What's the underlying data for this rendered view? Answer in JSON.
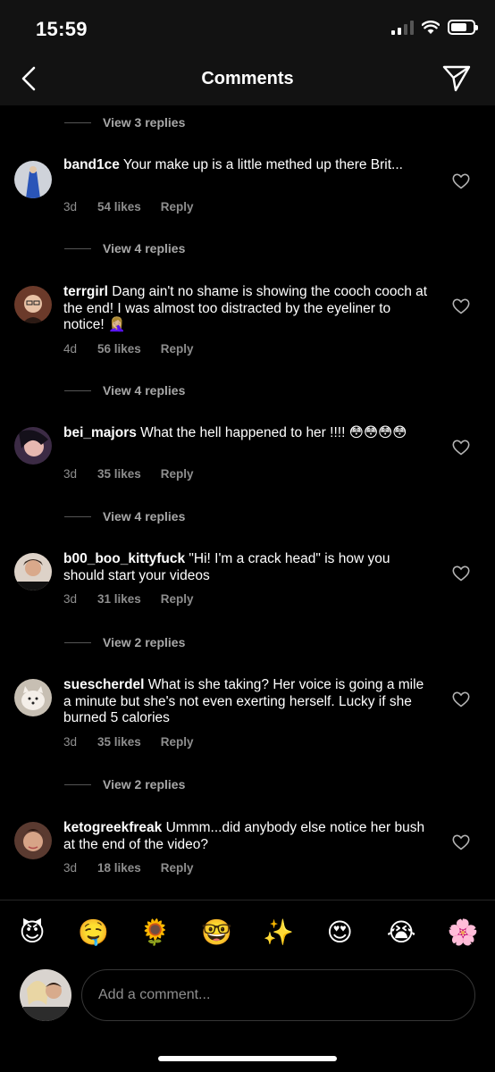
{
  "status": {
    "time": "15:59"
  },
  "header": {
    "title": "Comments"
  },
  "comments": [
    {
      "view_replies": "View 3 replies"
    },
    {
      "username": "band1ce",
      "text": " Your make up is a little methed up there Brit...",
      "time": "3d",
      "likes": "54 likes",
      "reply": "Reply",
      "view_replies": "View 4 replies"
    },
    {
      "username": "terrgirl",
      "text": " Dang ain't no shame is showing the cooch cooch at the end! I was almost too distracted by the eyeliner to notice! 🤦🏼‍♀️",
      "time": "4d",
      "likes": "56 likes",
      "reply": "Reply",
      "view_replies": "View 4 replies"
    },
    {
      "username": "bei_majors",
      "text": " What the hell happened to her !!!! 😳😳😳😳",
      "time": "3d",
      "likes": "35 likes",
      "reply": "Reply",
      "view_replies": "View 4 replies"
    },
    {
      "username": "b00_boo_kittyfuck",
      "text": " \"Hi! I'm a crack head\" is how you should start your videos",
      "time": "3d",
      "likes": "31 likes",
      "reply": "Reply",
      "view_replies": "View 2 replies"
    },
    {
      "username": "suescherdel",
      "text": " What is she taking?  Her voice is going a mile a minute but she's not even exerting herself. Lucky if she burned 5 calories",
      "time": "3d",
      "likes": "35 likes",
      "reply": "Reply",
      "view_replies": "View 2 replies"
    },
    {
      "username": "ketogreekfreak",
      "text": " Ummm...did anybody else notice her bush at the end of the video?",
      "time": "3d",
      "likes": "18 likes",
      "reply": "Reply"
    }
  ],
  "emoji_bar": [
    "😈",
    "🤤",
    "🌻",
    "🤓",
    "✨",
    "😍",
    "😭",
    "🌸"
  ],
  "composer": {
    "placeholder": "Add a comment..."
  },
  "colors": {
    "background": "#000000",
    "header": "#121212",
    "muted": "#8e8e8e",
    "replies": "#a8a8a8"
  }
}
